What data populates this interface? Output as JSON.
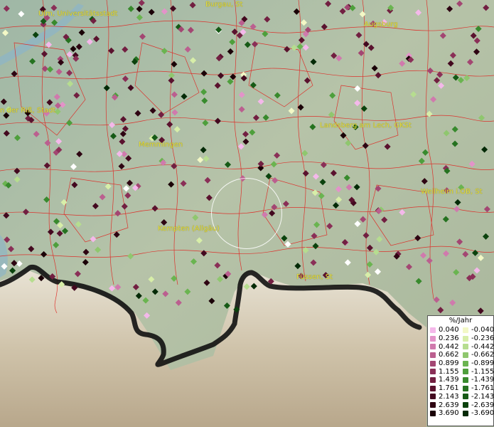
{
  "cities": [
    {
      "id": "ulm",
      "label": "Ulm, Universitätsstadt"
    },
    {
      "id": "burgau",
      "label": "Burgau, St"
    },
    {
      "id": "augsburg",
      "label": "Augsburg"
    },
    {
      "id": "neu-ulm",
      "label": "n der Riß, Stadt"
    },
    {
      "id": "landsberg",
      "label": "Landsberg am Lech, GKSt"
    },
    {
      "id": "memmingen",
      "label": "Memmingen"
    },
    {
      "id": "weilheim",
      "label": "Weilheim i.OB, St"
    },
    {
      "id": "kempten",
      "label": "Kempten (Allgäu)"
    },
    {
      "id": "fuessen",
      "label": "Füssen, St"
    }
  ],
  "legend": {
    "title": "%/Jahr",
    "positive": [
      {
        "value": "0.040",
        "color": "#f4b8ea"
      },
      {
        "value": "0.236",
        "color": "#e393c9"
      },
      {
        "value": "0.442",
        "color": "#d07aad"
      },
      {
        "value": "0.662",
        "color": "#bb5f8f"
      },
      {
        "value": "0.899",
        "color": "#a34672"
      },
      {
        "value": "1.155",
        "color": "#8a2f57"
      },
      {
        "value": "1.439",
        "color": "#721f41"
      },
      {
        "value": "1.761",
        "color": "#5a122e"
      },
      {
        "value": "2.143",
        "color": "#43091f"
      },
      {
        "value": "2.639",
        "color": "#2e0412"
      },
      {
        "value": "3.690",
        "color": "#1a0107"
      }
    ],
    "negative": [
      {
        "value": "-0.040",
        "color": "#f3f8c6"
      },
      {
        "value": "-0.236",
        "color": "#d7eea8"
      },
      {
        "value": "-0.442",
        "color": "#b6dd8f"
      },
      {
        "value": "-0.662",
        "color": "#8fc76e"
      },
      {
        "value": "-0.899",
        "color": "#6ab450"
      },
      {
        "value": "-1.155",
        "color": "#4e9f3c"
      },
      {
        "value": "-1.439",
        "color": "#388a2d"
      },
      {
        "value": "-1.761",
        "color": "#257220"
      },
      {
        "value": "-2.143",
        "color": "#165a16"
      },
      {
        "value": "-2.639",
        "color": "#0b420d"
      },
      {
        "value": "-3.690",
        "color": "#032a06"
      }
    ]
  }
}
